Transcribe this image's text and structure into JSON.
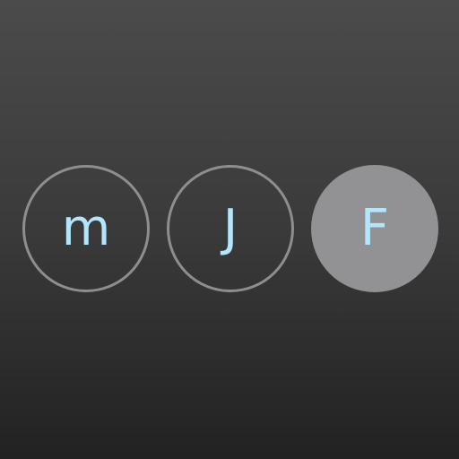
{
  "buttons": [
    {
      "label": "m",
      "selected": false
    },
    {
      "label": "J",
      "selected": false
    },
    {
      "label": "F",
      "selected": true
    }
  ],
  "colors": {
    "letter": "#b3e5fc",
    "ring": "#8e8e90",
    "selected_fill": "#929295"
  }
}
